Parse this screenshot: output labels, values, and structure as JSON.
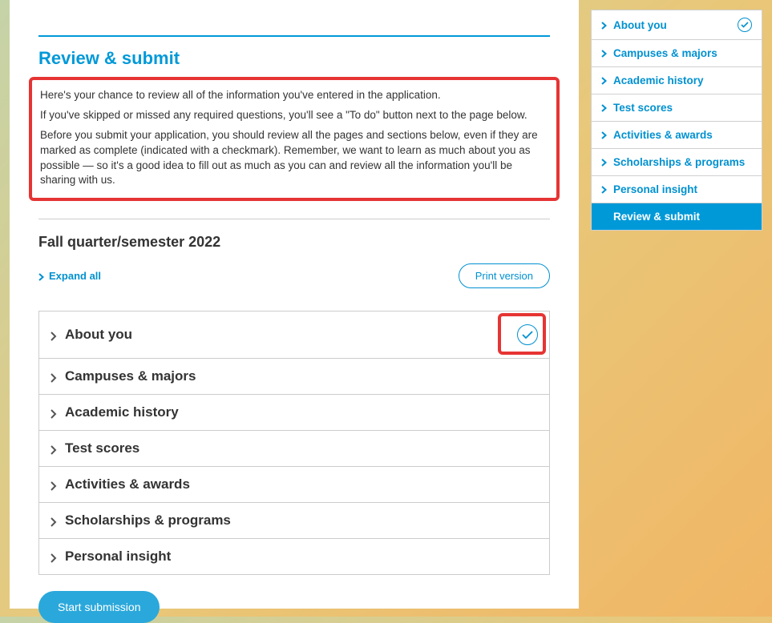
{
  "header": {
    "title": "Review & submit"
  },
  "intro": {
    "p1": "Here's your chance to review all of the information you've entered in the application.",
    "p2": "If you've skipped or missed any required questions, you'll see a \"To do\" button next to the page below.",
    "p3": "Before you submit your application, you should review all the pages and sections below, even if they are marked as complete (indicated with a checkmark). Remember, we want to learn as much about you as possible — so it's a good idea to fill out as much as you can and review all the information you'll be sharing with us."
  },
  "term": {
    "title": "Fall quarter/semester 2022"
  },
  "toolbar": {
    "expand_all": "Expand all",
    "print_version": "Print version"
  },
  "accordion": [
    {
      "label": "About you",
      "complete": true
    },
    {
      "label": "Campuses & majors",
      "complete": false
    },
    {
      "label": "Academic history",
      "complete": false
    },
    {
      "label": "Test scores",
      "complete": false
    },
    {
      "label": "Activities & awards",
      "complete": false
    },
    {
      "label": "Scholarships & programs",
      "complete": false
    },
    {
      "label": "Personal insight",
      "complete": false
    }
  ],
  "actions": {
    "start_submission": "Start submission"
  },
  "sidenav": [
    {
      "label": "About you",
      "complete": true,
      "active": false
    },
    {
      "label": "Campuses & majors",
      "complete": false,
      "active": false
    },
    {
      "label": "Academic history",
      "complete": false,
      "active": false
    },
    {
      "label": "Test scores",
      "complete": false,
      "active": false
    },
    {
      "label": "Activities & awards",
      "complete": false,
      "active": false
    },
    {
      "label": "Scholarships & programs",
      "complete": false,
      "active": false
    },
    {
      "label": "Personal insight",
      "complete": false,
      "active": false
    },
    {
      "label": "Review & submit",
      "complete": false,
      "active": true
    }
  ]
}
